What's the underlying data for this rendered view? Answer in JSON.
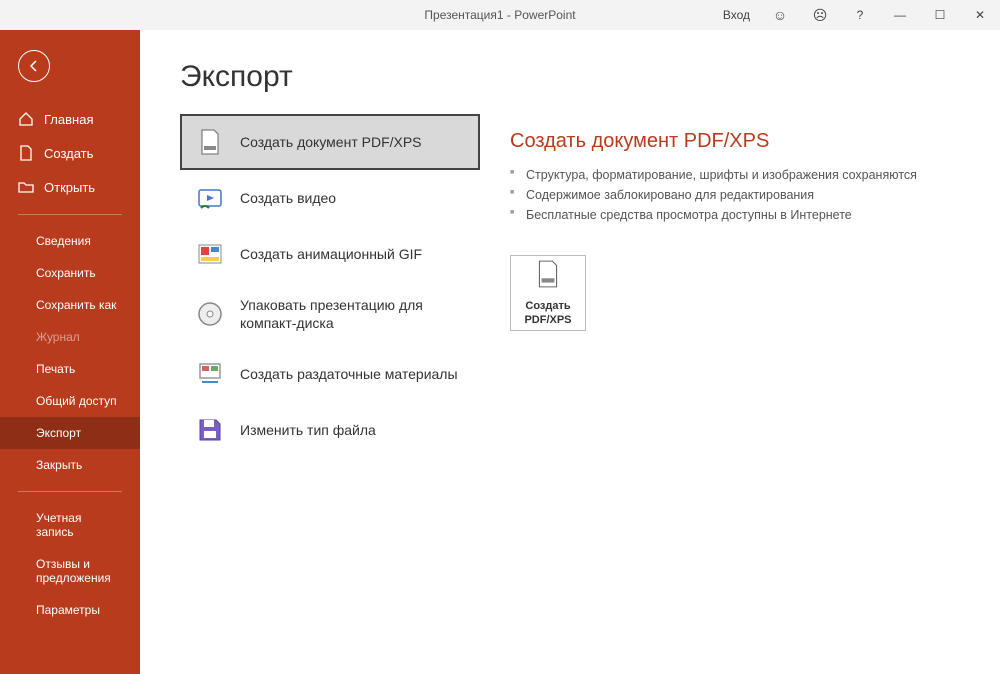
{
  "titlebar": {
    "title": "Презентация1 - PowerPoint",
    "login": "Вход",
    "happy": "☺",
    "sad": "☹",
    "help": "?",
    "min": "—",
    "max": "☐",
    "close": "✕"
  },
  "sidebar": {
    "home": "Главная",
    "create": "Создать",
    "open": "Открыть",
    "info": "Сведения",
    "save": "Сохранить",
    "saveas": "Сохранить как",
    "history": "Журнал",
    "print": "Печать",
    "share": "Общий доступ",
    "export": "Экспорт",
    "close": "Закрыть",
    "account": "Учетная запись",
    "feedback": "Отзывы и предложения",
    "options": "Параметры"
  },
  "page": {
    "title": "Экспорт"
  },
  "export_items": {
    "pdf": "Создать документ PDF/XPS",
    "video": "Создать видео",
    "gif": "Создать анимационный GIF",
    "cd": "Упаковать презентацию для компакт-диска",
    "handouts": "Создать раздаточные материалы",
    "filetype": "Изменить тип файла"
  },
  "detail": {
    "title": "Создать документ PDF/XPS",
    "b1": "Структура, форматирование, шрифты и изображения сохраняются",
    "b2": "Содержимое заблокировано для редактирования",
    "b3": "Бесплатные средства просмотра доступны в Интернете",
    "button": "Создать PDF/XPS"
  }
}
